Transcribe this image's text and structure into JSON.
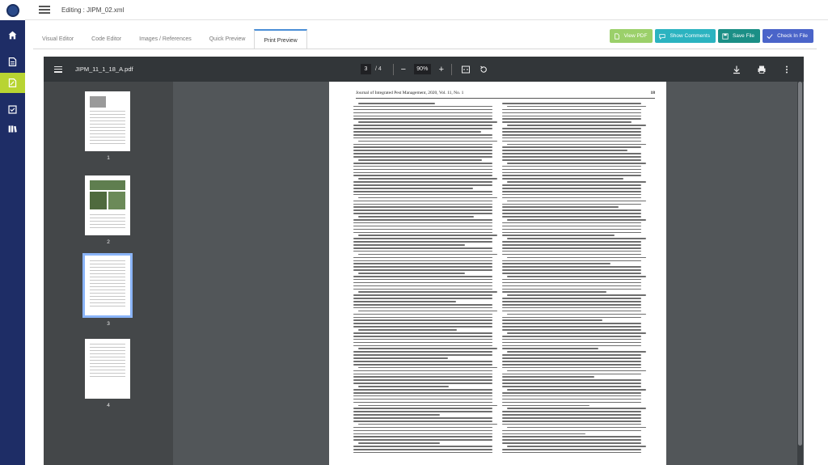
{
  "app": {
    "editing_label": "Editing : JIPM_02.xml"
  },
  "rail": {
    "items": [
      {
        "name": "home-icon",
        "active": false
      },
      {
        "name": "document-icon",
        "active": false
      },
      {
        "name": "edit-document-icon",
        "active": true
      },
      {
        "name": "checklist-icon",
        "active": false
      },
      {
        "name": "library-icon",
        "active": false
      }
    ]
  },
  "tabs": [
    {
      "label": "Visual Editor",
      "active": false
    },
    {
      "label": "Code Editor",
      "active": false
    },
    {
      "label": "Images / References",
      "active": false
    },
    {
      "label": "Quick Preview",
      "active": false
    },
    {
      "label": "Print Preview",
      "active": true
    }
  ],
  "actions": {
    "view_pdf": "View PDF",
    "show_comments": "Show Comments",
    "save_file": "Save File",
    "check_in_file": "Check In File"
  },
  "pdf": {
    "filename": "JIPM_11_1_18_A.pdf",
    "current_page": "3",
    "total_pages": "/ 4",
    "zoom": "90%",
    "thumbnails": [
      "1",
      "2",
      "3",
      "4"
    ],
    "selected_thumbnail": 3,
    "header_left": "Journal of Integrated Pest Management, 2020, Vol. 11, No. 1",
    "header_right": "18"
  },
  "colors": {
    "rail": "#1e2d66",
    "rail_active": "#b8d432",
    "view_pdf": "#9bd06a",
    "show_comments": "#2bb3c0",
    "save_file": "#1b8f86",
    "check_in_file": "#4a64c9",
    "viewer_bg": "#525659",
    "viewer_toolbar": "#323639"
  }
}
